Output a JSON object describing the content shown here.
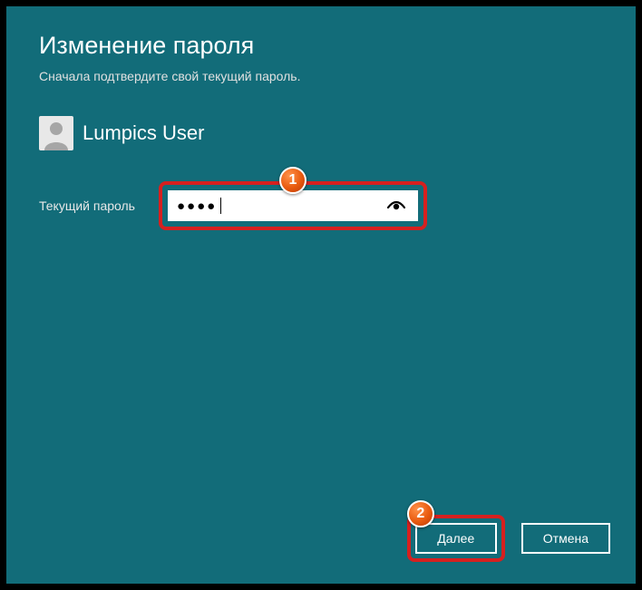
{
  "dialog": {
    "title": "Изменение пароля",
    "subtitle": "Сначала подтвердите свой текущий пароль."
  },
  "user": {
    "name": "Lumpics User"
  },
  "form": {
    "current_password_label": "Текущий пароль",
    "password_masked": "●●●●"
  },
  "buttons": {
    "next": "Далее",
    "cancel": "Отмена"
  },
  "annotations": {
    "step1": "1",
    "step2": "2"
  }
}
